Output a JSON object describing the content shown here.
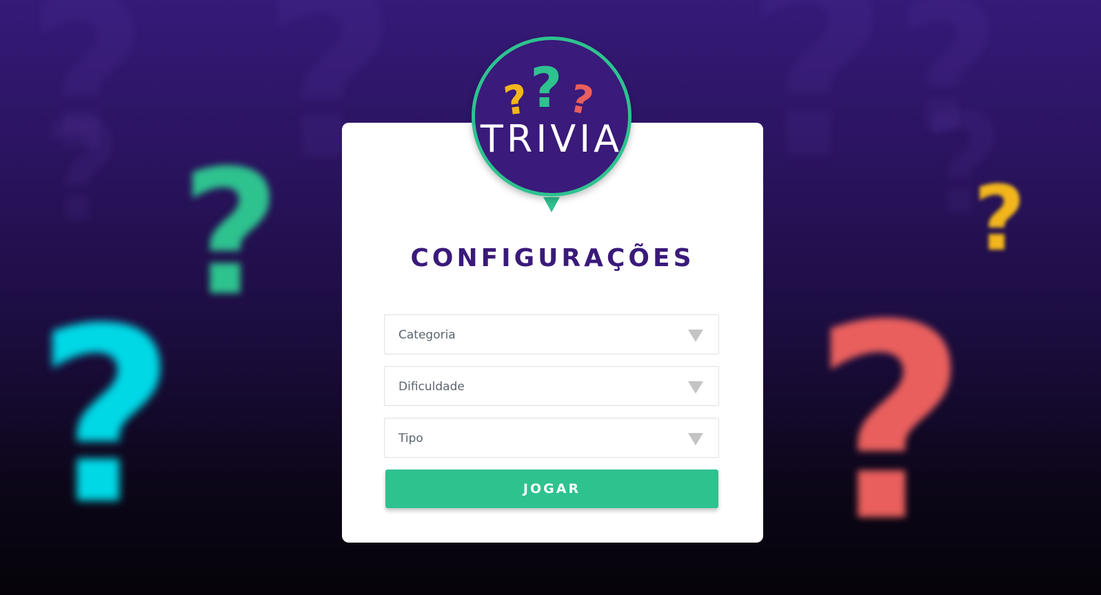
{
  "background": {
    "colors": {
      "top": "#351a78",
      "bottom": "#050309",
      "green": "#2ec28f",
      "cyan": "#00d8e6",
      "yellow": "#f2b61c",
      "red": "#e95f5d"
    },
    "marks": [
      "?",
      "?",
      "?",
      "?"
    ]
  },
  "logo": {
    "icon_marks": [
      "?",
      "?",
      "?"
    ],
    "text": "TRIVIA",
    "colors": {
      "fill": "#3a1a7a",
      "ring": "#2ec28f"
    }
  },
  "form": {
    "title": "CONFIGURAÇÕES",
    "selects": [
      {
        "label": "Categoria",
        "icon": "caret-down-icon"
      },
      {
        "label": "Dificuldade",
        "icon": "caret-down-icon"
      },
      {
        "label": "Tipo",
        "icon": "caret-down-icon"
      }
    ],
    "submit_label": "JOGAR",
    "colors": {
      "title": "#3a1a7a",
      "button": "#2ec28f"
    }
  }
}
